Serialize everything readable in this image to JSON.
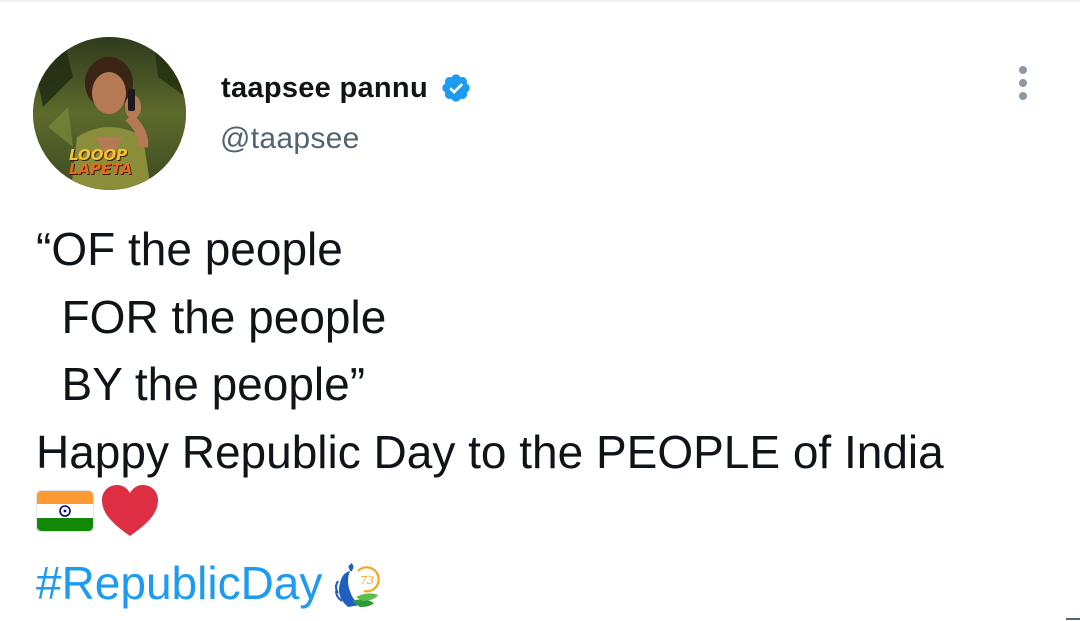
{
  "author": {
    "display_name": "taapsee pannu",
    "handle": "@taapsee",
    "verified": true,
    "avatar": {
      "poster_title_line1": "LOOOP",
      "poster_title_line2": "LAPETA"
    }
  },
  "tweet": {
    "lines": [
      "“OF the people",
      "  FOR the people",
      "  BY the people”",
      "Happy Republic Day to the PEOPLE of India"
    ],
    "emojis": [
      "india-flag-icon",
      "red-heart-icon"
    ],
    "hashtag": "#RepublicDay",
    "hashtag_emoji": "peacock-73-icon",
    "hashtag_emoji_text": "73"
  },
  "colors": {
    "link": "#1d9bf0",
    "verified": "#1d9bf0",
    "text": "#0f1419",
    "secondary_text": "#536471",
    "flag_saffron": "#ff9933",
    "flag_green": "#138808",
    "flag_chakra": "#000080",
    "heart": "#dd2e44"
  },
  "icons": {
    "more": "more-options-icon",
    "verified": "verified-badge-icon"
  }
}
